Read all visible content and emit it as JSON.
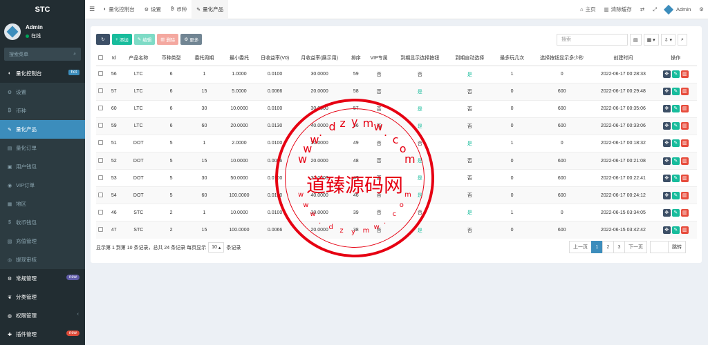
{
  "brand": "STC",
  "user": {
    "name": "Admin",
    "status": "在线"
  },
  "sidebar_search_placeholder": "搜索菜单",
  "menu": [
    {
      "label": "量化控制台",
      "icon": "dashboard-icon",
      "glyph": "◐",
      "type": "head",
      "badge": "hot"
    },
    {
      "label": "设置",
      "icon": "gear-icon",
      "glyph": "⚙",
      "type": "sub"
    },
    {
      "label": "币种",
      "icon": "bitcoin-icon",
      "glyph": "₿",
      "type": "sub"
    },
    {
      "label": "量化产品",
      "icon": "product-icon",
      "glyph": "✎",
      "type": "active"
    },
    {
      "label": "量化订单",
      "icon": "order-icon",
      "glyph": "▤",
      "type": "sub"
    },
    {
      "label": "用户钱包",
      "icon": "wallet-icon",
      "glyph": "▣",
      "type": "sub"
    },
    {
      "label": "VIP订单",
      "icon": "vip-icon",
      "glyph": "◉",
      "type": "sub"
    },
    {
      "label": "地区",
      "icon": "region-icon",
      "glyph": "▦",
      "type": "sub"
    },
    {
      "label": "收币钱包",
      "icon": "dollar-icon",
      "glyph": "$",
      "type": "sub"
    },
    {
      "label": "充值管理",
      "icon": "recharge-icon",
      "glyph": "▧",
      "type": "sub"
    },
    {
      "label": "提现审核",
      "icon": "withdraw-icon",
      "glyph": "◎",
      "type": "sub"
    },
    {
      "label": "常规管理",
      "icon": "cogs-icon",
      "glyph": "⚙",
      "type": "head",
      "badge": "new"
    },
    {
      "label": "分类管理",
      "icon": "leaf-icon",
      "glyph": "❦",
      "type": "head"
    },
    {
      "label": "权限管理",
      "icon": "group-icon",
      "glyph": "◍",
      "type": "head",
      "chevron": "‹"
    },
    {
      "label": "插件管理",
      "icon": "plugin-icon",
      "glyph": "✚",
      "type": "head",
      "badge": "new"
    }
  ],
  "tabs": [
    {
      "label": "量化控制台",
      "icon": "dashboard-icon",
      "glyph": "◐"
    },
    {
      "label": "设置",
      "icon": "gear-icon",
      "glyph": "⚙"
    },
    {
      "label": "币种",
      "icon": "bitcoin-icon",
      "glyph": "₿"
    },
    {
      "label": "量化产品",
      "icon": "product-icon",
      "glyph": "✎",
      "active": true
    }
  ],
  "topbar_right": {
    "home": "主页",
    "clear_cache": "清除缓存",
    "admin": "Admin"
  },
  "toolbar": {
    "add": "添加",
    "edit": "编辑",
    "delete": "删除",
    "more": "更多"
  },
  "table_search_placeholder": "搜索",
  "columns": [
    "Id",
    "产品名称",
    "币种类型",
    "委托周期",
    "最小委托",
    "日收益率(V0)",
    "月收益率(展示用)",
    "排序",
    "VIP专属",
    "到期显示选择按钮",
    "到期自动选择",
    "最多玩几次",
    "选择按钮显示多少秒",
    "创建时间",
    "操作"
  ],
  "rows": [
    [
      "56",
      "LTC",
      "6",
      "1",
      "1.0000",
      "0.0100",
      "30.0000",
      "59",
      "否",
      "否",
      "是",
      "1",
      "0",
      "2022-06-17 00:28:33"
    ],
    [
      "57",
      "LTC",
      "6",
      "15",
      "5.0000",
      "0.0066",
      "20.0000",
      "58",
      "否",
      "是",
      "否",
      "0",
      "600",
      "2022-06-17 00:29:48"
    ],
    [
      "60",
      "LTC",
      "6",
      "30",
      "10.0000",
      "0.0100",
      "30.0000",
      "57",
      "否",
      "是",
      "否",
      "0",
      "600",
      "2022-06-17 00:35:06"
    ],
    [
      "59",
      "LTC",
      "6",
      "60",
      "20.0000",
      "0.0130",
      "40.0000",
      "56",
      "否",
      "是",
      "否",
      "0",
      "600",
      "2022-06-17 00:33:06"
    ],
    [
      "51",
      "DOT",
      "5",
      "1",
      "2.0000",
      "0.0100",
      "30.0000",
      "49",
      "否",
      "否",
      "是",
      "1",
      "0",
      "2022-06-17 00:18:32"
    ],
    [
      "52",
      "DOT",
      "5",
      "15",
      "10.0000",
      "0.0066",
      "20.0000",
      "48",
      "否",
      "是",
      "否",
      "0",
      "600",
      "2022-06-17 00:21:08"
    ],
    [
      "53",
      "DOT",
      "5",
      "30",
      "50.0000",
      "0.0100",
      "30.0000",
      "47",
      "否",
      "是",
      "否",
      "0",
      "600",
      "2022-06-17 00:22:41"
    ],
    [
      "54",
      "DOT",
      "5",
      "60",
      "100.0000",
      "0.0130",
      "40.0000",
      "46",
      "否",
      "是",
      "否",
      "0",
      "600",
      "2022-06-17 00:24:12"
    ],
    [
      "46",
      "STC",
      "2",
      "1",
      "10.0000",
      "0.0100",
      "30.0000",
      "39",
      "否",
      "否",
      "是",
      "1",
      "0",
      "2022-06-15 03:34:05"
    ],
    [
      "47",
      "STC",
      "2",
      "15",
      "100.0000",
      "0.0066",
      "20.0000",
      "38",
      "否",
      "是",
      "否",
      "0",
      "600",
      "2022-06-15 03:42:42"
    ]
  ],
  "footer": {
    "info_prefix": "显示第 1 到第 10 条记录，总共 24 条记录 每页显示",
    "page_size": "10",
    "info_suffix": "条记录"
  },
  "pager": {
    "prev": "上一页",
    "pages": [
      "1",
      "2",
      "3"
    ],
    "next": "下一页",
    "jump": "跳转"
  },
  "watermark": {
    "text": "道臻源码网",
    "url": "www.dzymw.com"
  },
  "colors": {
    "primary": "#3c8dbc",
    "success": "#18bc9c",
    "danger": "#e74c3c",
    "sidebar": "#222d32",
    "stamp": "#e60012"
  }
}
